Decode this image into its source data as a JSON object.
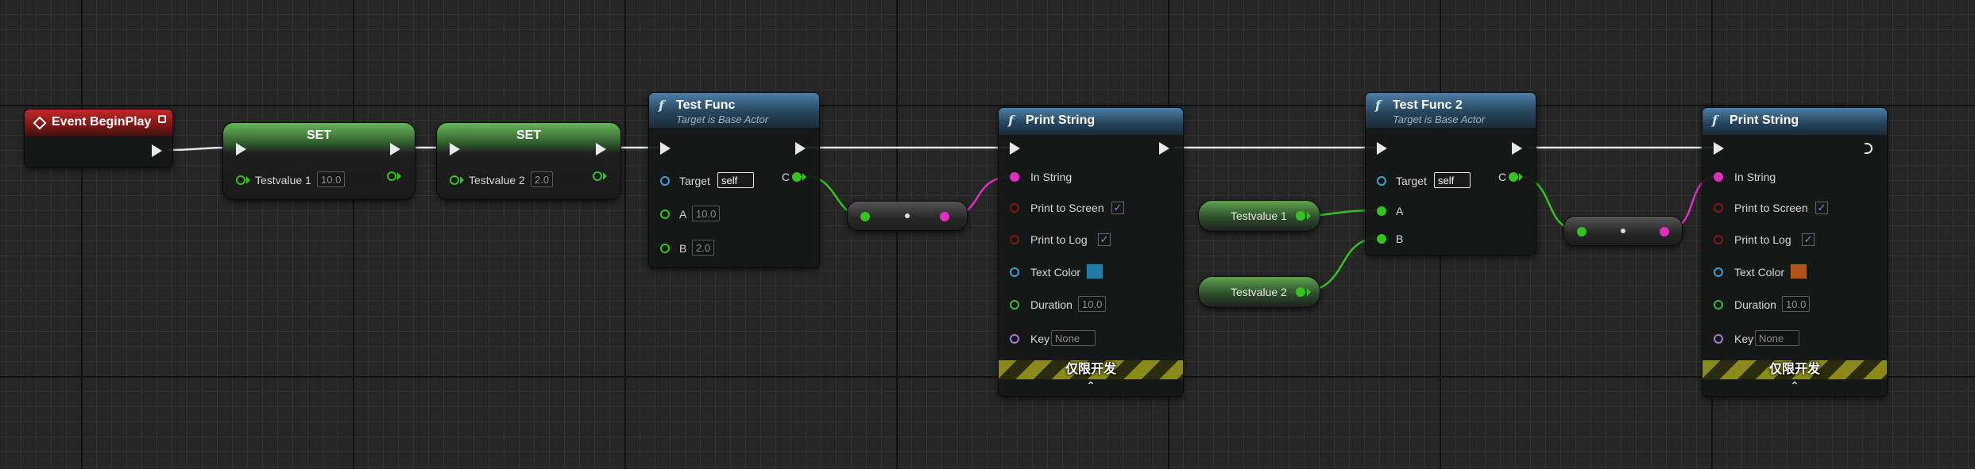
{
  "begin_play": {
    "title": "Event BeginPlay"
  },
  "set1": {
    "title": "SET",
    "var": "Testvalue 1",
    "value": "10.0"
  },
  "set2": {
    "title": "SET",
    "var": "Testvalue 2",
    "value": "2.0"
  },
  "func1": {
    "title": "Test Func",
    "subtitle": "Target is Base Actor",
    "target_label": "Target",
    "target_value": "self",
    "a_label": "A",
    "a_value": "10.0",
    "b_label": "B",
    "b_value": "2.0",
    "c_label": "C"
  },
  "func2": {
    "title": "Test Func 2",
    "subtitle": "Target is Base Actor",
    "target_label": "Target",
    "target_value": "self",
    "a_label": "A",
    "b_label": "B",
    "c_label": "C"
  },
  "print1": {
    "title": "Print String",
    "in_string": "In String",
    "print_screen": "Print to Screen",
    "print_log": "Print to Log",
    "text_color": "Text Color",
    "text_color_hex": "#1f7ea8",
    "duration": "Duration",
    "duration_value": "10.0",
    "key": "Key",
    "key_value": "None",
    "dev_only": "仅限开发",
    "collapse": "⌃"
  },
  "print2": {
    "title": "Print String",
    "in_string": "In String",
    "print_screen": "Print to Screen",
    "print_log": "Print to Log",
    "text_color": "Text Color",
    "text_color_hex": "#b5521b",
    "duration": "Duration",
    "duration_value": "10.0",
    "key": "Key",
    "key_value": "None",
    "dev_only": "仅限开发",
    "collapse": "⌃"
  },
  "get1": {
    "var": "Testvalue 1"
  },
  "get2": {
    "var": "Testvalue 2"
  },
  "check": "✓"
}
